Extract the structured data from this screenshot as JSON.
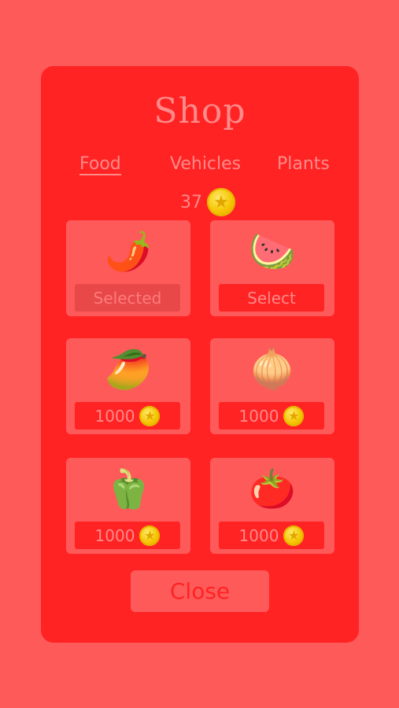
{
  "shop": {
    "title": "Shop",
    "tabs": [
      {
        "label": "Food",
        "active": true
      },
      {
        "label": "Vehicles",
        "active": false
      },
      {
        "label": "Plants",
        "active": false
      }
    ],
    "balance": "37",
    "items": [
      {
        "name": "chili-pepper",
        "emoji": "🌶️",
        "button": "Selected",
        "state": "selected"
      },
      {
        "name": "watermelon",
        "emoji": "🍉",
        "button": "Select",
        "state": "owned"
      },
      {
        "name": "mango",
        "emoji": "🥭",
        "button": "1000",
        "state": "locked"
      },
      {
        "name": "onion",
        "emoji": "🧅",
        "button": "1000",
        "state": "locked"
      },
      {
        "name": "bell-pepper",
        "emoji": "🫑",
        "button": "1000",
        "state": "locked"
      },
      {
        "name": "tomato",
        "emoji": "🍅",
        "button": "1000",
        "state": "locked"
      }
    ],
    "close_label": "Close"
  },
  "colors": {
    "background": "#ff5a5a",
    "panel": "#ff2323",
    "text": "#ff8a8a",
    "coin": "#f5c400"
  },
  "icons": {
    "coin": "coin-star-icon"
  }
}
